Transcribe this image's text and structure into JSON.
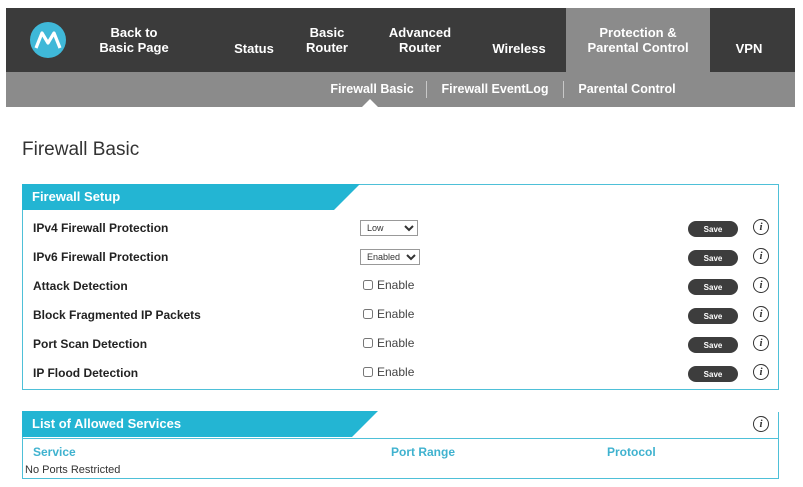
{
  "nav": {
    "back": "Back to\nBasic Page",
    "status": "Status",
    "basic_router": "Basic\nRouter",
    "advanced_router": "Advanced\nRouter",
    "wireless": "Wireless",
    "protection": "Protection &\nParental Control",
    "vpn": "VPN"
  },
  "subnav": {
    "items": [
      "Firewall Basic",
      "Firewall EventLog",
      "Parental Control"
    ],
    "active": "Firewall Basic"
  },
  "page_title": "Firewall Basic",
  "firewall_setup": {
    "title": "Firewall Setup",
    "rows": [
      {
        "label": "IPv4 Firewall Protection",
        "type": "select",
        "value": "Low",
        "save": "Save"
      },
      {
        "label": "IPv6 Firewall Protection",
        "type": "select",
        "value": "Enabled",
        "save": "Save"
      },
      {
        "label": "Attack Detection",
        "type": "checkbox",
        "value": "Enable",
        "save": "Save"
      },
      {
        "label": "Block Fragmented IP Packets",
        "type": "checkbox",
        "value": "Enable",
        "save": "Save"
      },
      {
        "label": "Port Scan Detection",
        "type": "checkbox",
        "value": "Enable",
        "save": "Save"
      },
      {
        "label": "IP Flood Detection",
        "type": "checkbox",
        "value": "Enable",
        "save": "Save"
      }
    ]
  },
  "allowed_services": {
    "title": "List of Allowed Services",
    "columns": [
      "Service",
      "Port Range",
      "Protocol"
    ],
    "empty": "No Ports Restricted"
  },
  "colors": {
    "nav_bg": "#3b3b3b",
    "subnav_bg": "#8b8b8b",
    "accent": "#23b5d3",
    "logo": "#3fb8d8"
  }
}
